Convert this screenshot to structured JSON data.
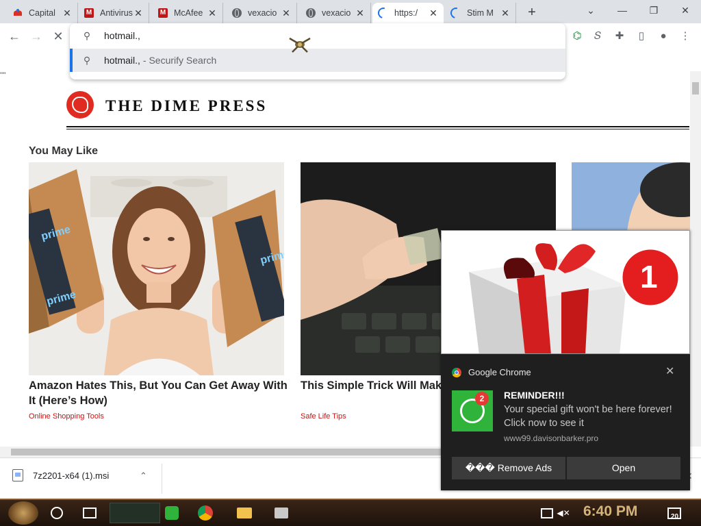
{
  "tabs": [
    {
      "title": "Capital",
      "icon": "capital-favicon-icon"
    },
    {
      "title": "Antivirus",
      "icon": "mcafee-icon"
    },
    {
      "title": "McAfee",
      "icon": "mcafee-icon"
    },
    {
      "title": "vexacio",
      "icon": "globe-icon"
    },
    {
      "title": "vexacio",
      "icon": "globe-icon"
    },
    {
      "title": "https:/",
      "icon": "loading-spinner-icon",
      "active": true
    },
    {
      "title": "Stim M",
      "icon": "loading-spinner-icon"
    }
  ],
  "tab_close_glyph": "✕",
  "newtab_glyph": "+",
  "window": {
    "dropdown": "⌄",
    "minimize": "—",
    "restore": "❐",
    "close": "✕"
  },
  "toolbar": {
    "back": "←",
    "forward": "→",
    "stop": "✕",
    "ext_icons": [
      "⌬",
      "𝑆",
      "✚",
      "▯",
      "●",
      "⋮"
    ]
  },
  "omnibox": {
    "value": "hotmail.,",
    "search_glyph": "⚲",
    "suggestion_query": "hotmail.,",
    "suggestion_provider": "- Securify Search"
  },
  "page": {
    "quote_marks": "''''",
    "site_name": "THE DIME PRESS",
    "section_title": "You May Like",
    "cards": [
      {
        "title": "Amazon Hates This, But You Can Get Away With It (Here’s How)",
        "source": "Online Shopping Tools"
      },
      {
        "title": "This Simple Trick Will Make (Do It Now)",
        "source": "Safe Life Tips"
      }
    ],
    "box_labels": [
      "prime",
      "prime",
      "prime"
    ]
  },
  "download": {
    "filename": "7z2201-x64 (1).msi",
    "chevron": "⌃",
    "close": "✕"
  },
  "taskbar": {
    "time": "6:40 PM",
    "notifications_count": "20"
  },
  "notification": {
    "app": "Google Chrome",
    "close": "✕",
    "badge_count_gift": "1",
    "badge_count_app": "2",
    "title": "REMINDER!!!",
    "message": "Your special gift won't be here forever! Click now to see it",
    "url": "www99.davisonbarker.pro",
    "buttons": {
      "remove": "��� Remove Ads",
      "open": "Open"
    }
  }
}
